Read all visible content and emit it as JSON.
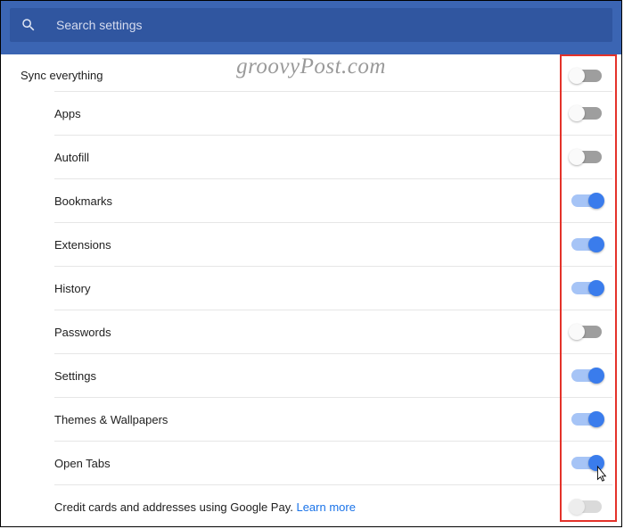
{
  "search": {
    "placeholder": "Search settings"
  },
  "watermark": "groovyPost.com",
  "sync_everything": {
    "label": "Sync everything",
    "state": "off"
  },
  "items": [
    {
      "label": "Apps",
      "state": "off"
    },
    {
      "label": "Autofill",
      "state": "off"
    },
    {
      "label": "Bookmarks",
      "state": "on"
    },
    {
      "label": "Extensions",
      "state": "on"
    },
    {
      "label": "History",
      "state": "on"
    },
    {
      "label": "Passwords",
      "state": "off"
    },
    {
      "label": "Settings",
      "state": "on"
    },
    {
      "label": "Themes & Wallpapers",
      "state": "on"
    },
    {
      "label": "Open Tabs",
      "state": "on"
    }
  ],
  "google_pay": {
    "text": "Credit cards and addresses using Google Pay. ",
    "link": "Learn more",
    "state": "disabled"
  }
}
